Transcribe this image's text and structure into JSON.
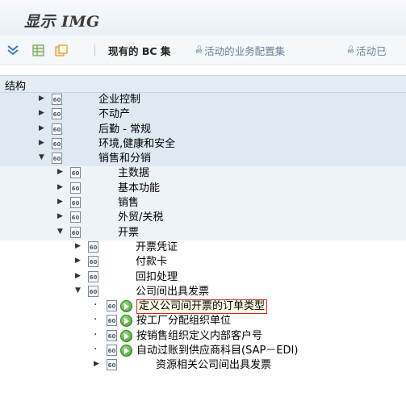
{
  "window": {
    "title": "显示 IMG"
  },
  "toolbar": {
    "existing_bc_label": "现有的 BC 集",
    "active_bc_label": "活动的业务配置集",
    "active_bc_label2": "活动已"
  },
  "tree": {
    "header": "结构",
    "items": [
      {
        "label": "企业控制",
        "level": 0,
        "state": "collapsed"
      },
      {
        "label": "不动产",
        "level": 0,
        "state": "collapsed"
      },
      {
        "label": "后勤 - 常规",
        "level": 0,
        "state": "collapsed"
      },
      {
        "label": "环境,健康和安全",
        "level": 0,
        "state": "collapsed"
      },
      {
        "label": "销售和分销",
        "level": 0,
        "state": "expanded"
      },
      {
        "label": "主数据",
        "level": 1,
        "state": "collapsed"
      },
      {
        "label": "基本功能",
        "level": 1,
        "state": "collapsed"
      },
      {
        "label": "销售",
        "level": 1,
        "state": "collapsed"
      },
      {
        "label": "外贸/关税",
        "level": 1,
        "state": "collapsed"
      },
      {
        "label": "开票",
        "level": 1,
        "state": "expanded"
      },
      {
        "label": "开票凭证",
        "level": 2,
        "state": "collapsed"
      },
      {
        "label": "付款卡",
        "level": 2,
        "state": "collapsed"
      },
      {
        "label": "回扣处理",
        "level": 2,
        "state": "collapsed"
      },
      {
        "label": "公司间出具发票",
        "level": 2,
        "state": "expanded"
      },
      {
        "label": "定义公司间开票的订单类型",
        "level": 3,
        "state": "activity",
        "selected": true
      },
      {
        "label": "按工厂分配组织单位",
        "level": 3,
        "state": "activity"
      },
      {
        "label": "按销售组织定义内部客户号",
        "level": 3,
        "state": "activity"
      },
      {
        "label": "自动过账到供应商科目(SAP－EDI)",
        "level": 3,
        "state": "activity"
      },
      {
        "label": "资源相关公司间出具发票",
        "level": 3,
        "state": "collapsed"
      }
    ]
  }
}
